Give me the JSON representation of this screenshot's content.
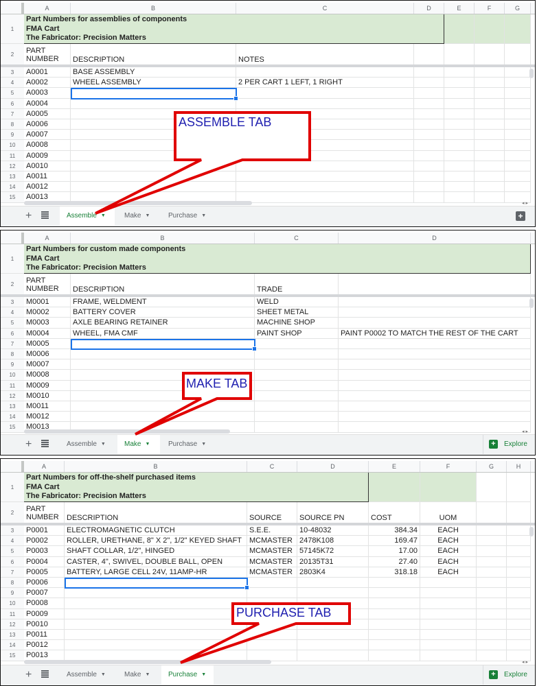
{
  "app": "Google Sheets",
  "tabs": [
    "Assemble",
    "Make",
    "Purchase"
  ],
  "explore_label": "Explore",
  "colors": {
    "header_fill": "#d9ead3",
    "active_tab": "#188038",
    "callout_border": "#e00000",
    "callout_text": "#2020b0",
    "selection": "#1a73e8"
  },
  "panels": {
    "assemble": {
      "active_tab": "Assemble",
      "callout": "ASSEMBLE TAB",
      "columns": [
        "A",
        "B",
        "C",
        "D",
        "E",
        "F",
        "G"
      ],
      "title_lines": [
        "Part Numbers for assemblies of components",
        "FMA Cart",
        "The Fabricator: Precision Matters"
      ],
      "header": {
        "part_1": "PART",
        "part_2": "NUMBER",
        "description": "DESCRIPTION",
        "notes": "NOTES"
      },
      "row_numbers": [
        "1",
        "2",
        "3",
        "4",
        "5",
        "6",
        "7",
        "8",
        "9",
        "10",
        "11",
        "12",
        "13",
        "14",
        "15"
      ],
      "rows": [
        {
          "pn": "A0001",
          "desc": "BASE ASSEMBLY",
          "notes": ""
        },
        {
          "pn": "A0002",
          "desc": "WHEEL ASSEMBLY",
          "notes": "2 PER CART 1 LEFT, 1 RIGHT"
        },
        {
          "pn": "A0003",
          "desc": "",
          "notes": ""
        },
        {
          "pn": "A0004",
          "desc": "",
          "notes": ""
        },
        {
          "pn": "A0005",
          "desc": "",
          "notes": ""
        },
        {
          "pn": "A0006",
          "desc": "",
          "notes": ""
        },
        {
          "pn": "A0007",
          "desc": "",
          "notes": ""
        },
        {
          "pn": "A0008",
          "desc": "",
          "notes": ""
        },
        {
          "pn": "A0009",
          "desc": "",
          "notes": ""
        },
        {
          "pn": "A0010",
          "desc": "",
          "notes": ""
        },
        {
          "pn": "A0011",
          "desc": "",
          "notes": ""
        },
        {
          "pn": "A0012",
          "desc": "",
          "notes": ""
        },
        {
          "pn": "A0013",
          "desc": "",
          "notes": ""
        }
      ],
      "selected_cell": "B5"
    },
    "make": {
      "active_tab": "Make",
      "callout": "MAKE TAB",
      "columns": [
        "A",
        "B",
        "C",
        "D"
      ],
      "title_lines": [
        "Part Numbers for custom made components",
        "FMA Cart",
        "The Fabricator: Precision Matters"
      ],
      "header": {
        "part_1": "PART",
        "part_2": "NUMBER",
        "description": "DESCRIPTION",
        "trade": "TRADE"
      },
      "row_numbers": [
        "1",
        "2",
        "3",
        "4",
        "5",
        "6",
        "7",
        "8",
        "9",
        "10",
        "11",
        "12",
        "13",
        "14",
        "15"
      ],
      "rows": [
        {
          "pn": "M0001",
          "desc": "FRAME, WELDMENT",
          "trade": "WELD",
          "note": ""
        },
        {
          "pn": "M0002",
          "desc": "BATTERY COVER",
          "trade": "SHEET METAL",
          "note": ""
        },
        {
          "pn": "M0003",
          "desc": "AXLE BEARING RETAINER",
          "trade": "MACHINE SHOP",
          "note": ""
        },
        {
          "pn": "M0004",
          "desc": "WHEEL, FMA CMF",
          "trade": "PAINT SHOP",
          "note": "PAINT P0002 TO MATCH THE REST OF THE CART"
        },
        {
          "pn": "M0005",
          "desc": "",
          "trade": "",
          "note": ""
        },
        {
          "pn": "M0006",
          "desc": "",
          "trade": "",
          "note": ""
        },
        {
          "pn": "M0007",
          "desc": "",
          "trade": "",
          "note": ""
        },
        {
          "pn": "M0008",
          "desc": "",
          "trade": "",
          "note": ""
        },
        {
          "pn": "M0009",
          "desc": "",
          "trade": "",
          "note": ""
        },
        {
          "pn": "M0010",
          "desc": "",
          "trade": "",
          "note": ""
        },
        {
          "pn": "M0011",
          "desc": "",
          "trade": "",
          "note": ""
        },
        {
          "pn": "M0012",
          "desc": "",
          "trade": "",
          "note": ""
        },
        {
          "pn": "M0013",
          "desc": "",
          "trade": "",
          "note": ""
        }
      ],
      "selected_cell": "B7"
    },
    "purchase": {
      "active_tab": "Purchase",
      "callout": "PURCHASE TAB",
      "columns": [
        "A",
        "B",
        "C",
        "D",
        "E",
        "F",
        "G",
        "H"
      ],
      "title_lines": [
        "Part Numbers for off-the-shelf purchased items",
        "FMA Cart",
        "The Fabricator: Precision Matters"
      ],
      "header": {
        "part_1": "PART",
        "part_2": "NUMBER",
        "description": "DESCRIPTION",
        "source": "SOURCE",
        "source_pn": "SOURCE PN",
        "cost": "COST",
        "uom": "UOM"
      },
      "row_numbers": [
        "1",
        "2",
        "3",
        "4",
        "5",
        "6",
        "7",
        "8",
        "9",
        "10",
        "11",
        "12",
        "13",
        "14",
        "15"
      ],
      "rows": [
        {
          "pn": "P0001",
          "desc": "ELECTROMAGNETIC CLUTCH",
          "source": "S.E.E.",
          "source_pn": "10-48032",
          "cost": "384.34",
          "uom": "EACH"
        },
        {
          "pn": "P0002",
          "desc": "ROLLER, URETHANE, 8\" X 2\", 1/2\" KEYED SHAFT",
          "source": "MCMASTER",
          "source_pn": "2478K108",
          "cost": "169.47",
          "uom": "EACH"
        },
        {
          "pn": "P0003",
          "desc": "SHAFT COLLAR, 1/2\", HINGED",
          "source": "MCMASTER",
          "source_pn": "57145K72",
          "cost": "17.00",
          "uom": "EACH"
        },
        {
          "pn": "P0004",
          "desc": "CASTER, 4\", SWIVEL, DOUBLE BALL, OPEN",
          "source": "MCMASTER",
          "source_pn": "20135T31",
          "cost": "27.40",
          "uom": "EACH"
        },
        {
          "pn": "P0005",
          "desc": "BATTERY, LARGE CELL 24V, 11AMP-HR",
          "source": "MCMASTER",
          "source_pn": "2803K4",
          "cost": "318.18",
          "uom": "EACH"
        },
        {
          "pn": "P0006",
          "desc": "",
          "source": "",
          "source_pn": "",
          "cost": "",
          "uom": ""
        },
        {
          "pn": "P0007",
          "desc": "",
          "source": "",
          "source_pn": "",
          "cost": "",
          "uom": ""
        },
        {
          "pn": "P0008",
          "desc": "",
          "source": "",
          "source_pn": "",
          "cost": "",
          "uom": ""
        },
        {
          "pn": "P0009",
          "desc": "",
          "source": "",
          "source_pn": "",
          "cost": "",
          "uom": ""
        },
        {
          "pn": "P0010",
          "desc": "",
          "source": "",
          "source_pn": "",
          "cost": "",
          "uom": ""
        },
        {
          "pn": "P0011",
          "desc": "",
          "source": "",
          "source_pn": "",
          "cost": "",
          "uom": ""
        },
        {
          "pn": "P0012",
          "desc": "",
          "source": "",
          "source_pn": "",
          "cost": "",
          "uom": ""
        },
        {
          "pn": "P0013",
          "desc": "",
          "source": "",
          "source_pn": "",
          "cost": "",
          "uom": ""
        }
      ],
      "selected_cell": "B8"
    }
  }
}
